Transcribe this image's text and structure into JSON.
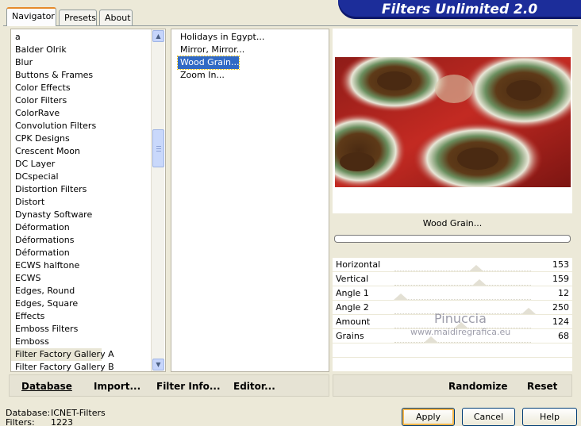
{
  "tabs": [
    {
      "label": "Navigator",
      "active": true
    },
    {
      "label": "Presets",
      "active": false
    },
    {
      "label": "About",
      "active": false
    }
  ],
  "brand_title": "Filters Unlimited 2.0",
  "categories": [
    "a",
    "Balder Olrik",
    "Blur",
    "Buttons & Frames",
    "Color Effects",
    "Color Filters",
    "ColorRave",
    "Convolution Filters",
    "CPK Designs",
    "Crescent Moon",
    "DC Layer",
    "DCspecial",
    "Distortion Filters",
    "Distort",
    "Dynasty Software",
    "Déformation",
    "Déformations",
    "Déformation",
    "ECWS halftone",
    "ECWS",
    "Edges, Round",
    "Edges, Square",
    "Effects",
    "Emboss Filters",
    "Emboss",
    "Filter Factory Gallery A",
    "Filter Factory Gallery B"
  ],
  "selected_category": "Filter Factory Gallery A",
  "filters": [
    "Holidays in Egypt...",
    "Mirror, Mirror...",
    "Wood Grain...",
    "Zoom In..."
  ],
  "selected_filter": "Wood Grain...",
  "filter_name": "Wood Grain...",
  "progress": 0,
  "params": [
    {
      "label": "Horizontal",
      "value": "153"
    },
    {
      "label": "Vertical",
      "value": "159"
    },
    {
      "label": "Angle 1",
      "value": "12"
    },
    {
      "label": "Angle 2",
      "value": "250"
    },
    {
      "label": "Amount",
      "value": "124"
    },
    {
      "label": "Grains",
      "value": "68"
    }
  ],
  "watermark": {
    "name": "Pinuccia",
    "url": "www.maidiregrafica.eu"
  },
  "left_buttons": {
    "database": "Database",
    "import": "Import...",
    "filter_info": "Filter Info...",
    "editor": "Editor..."
  },
  "right_buttons": {
    "randomize": "Randomize",
    "reset": "Reset"
  },
  "status": {
    "database_label": "Database:",
    "database_value": "ICNET-Filters",
    "filters_label": "Filters:",
    "filters_value": "1223"
  },
  "dialog_buttons": {
    "apply": "Apply",
    "cancel": "Cancel",
    "help": "Help"
  },
  "colors": {
    "brand_blue": "#1c2d9a",
    "selection_blue": "#316ac5",
    "window_bg": "#ece9d8"
  }
}
